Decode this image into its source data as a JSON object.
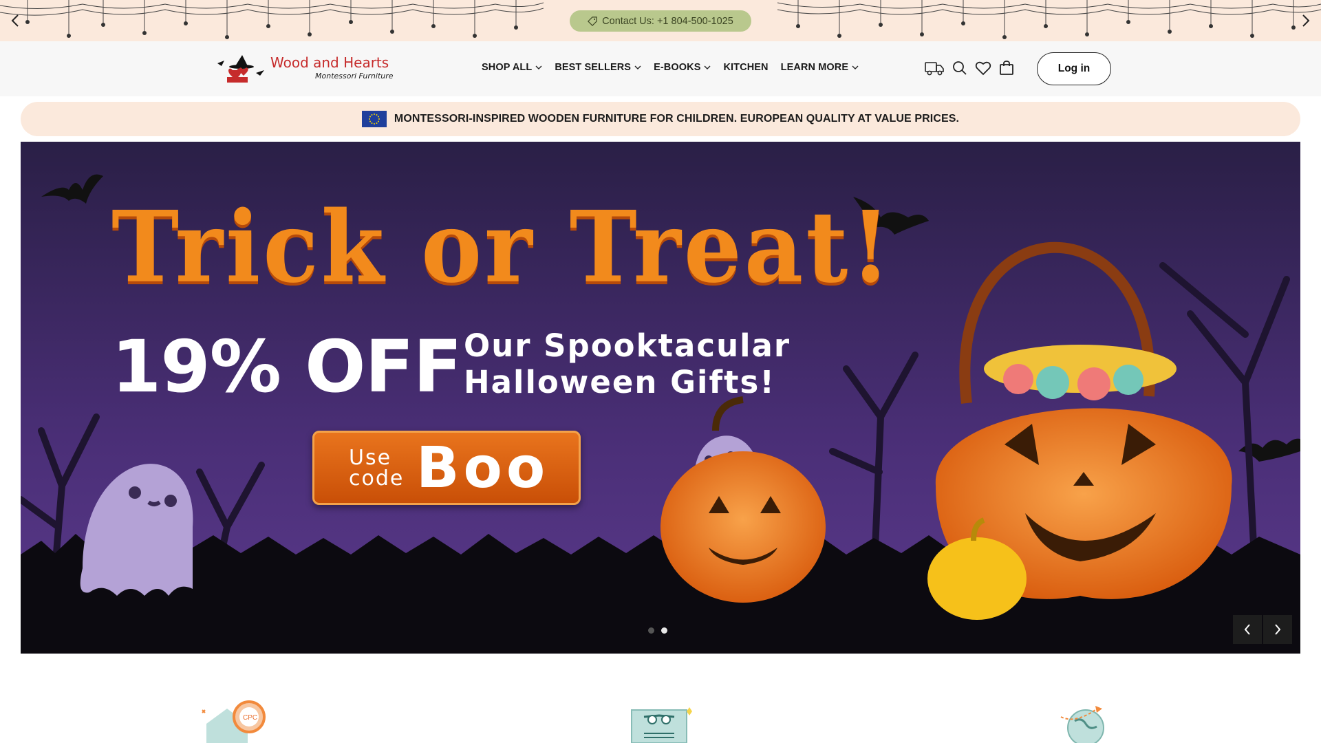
{
  "announcement": {
    "contact_text": "Contact Us: +1 804-500-1025",
    "prev_icon": "chevron-left-icon",
    "next_icon": "chevron-right-icon",
    "background_color": "#fbe9dc",
    "pill_color": "#b9c88d"
  },
  "header": {
    "logo": {
      "title": "Wood and Hearts",
      "subtitle": "Montessori Furniture"
    },
    "nav": [
      {
        "label": "SHOP ALL",
        "has_dropdown": true
      },
      {
        "label": "BEST SELLERS",
        "has_dropdown": true
      },
      {
        "label": "E-BOOKS",
        "has_dropdown": true
      },
      {
        "label": "KITCHEN",
        "has_dropdown": false
      },
      {
        "label": "LEARN MORE",
        "has_dropdown": true
      }
    ],
    "icons": [
      "truck-icon",
      "search-icon",
      "heart-icon",
      "cart-icon"
    ],
    "login_label": "Log in"
  },
  "promo": {
    "text": "MONTESSORI-INSPIRED WOODEN FURNITURE FOR CHILDREN. EUROPEAN QUALITY AT VALUE PRICES.",
    "flag_icon": "eu-flag-icon"
  },
  "hero": {
    "title": "Trick or Treat!",
    "discount": "19% OFF",
    "subtitle_line1": "Our Spooktacular",
    "subtitle_line2": "Halloween Gifts!",
    "code_prefix_line1": "Use",
    "code_prefix_line2": "code",
    "code": "Boo",
    "slide_count": 2,
    "active_slide": 2,
    "colors": {
      "sky": "#3a2558",
      "title_orange": "#f28a1c",
      "button_orange": "#d95f0e"
    }
  },
  "features": {
    "icons": [
      "cpc-certified-house-icon",
      "award-certificate-icon",
      "globe-shipping-icon"
    ]
  }
}
